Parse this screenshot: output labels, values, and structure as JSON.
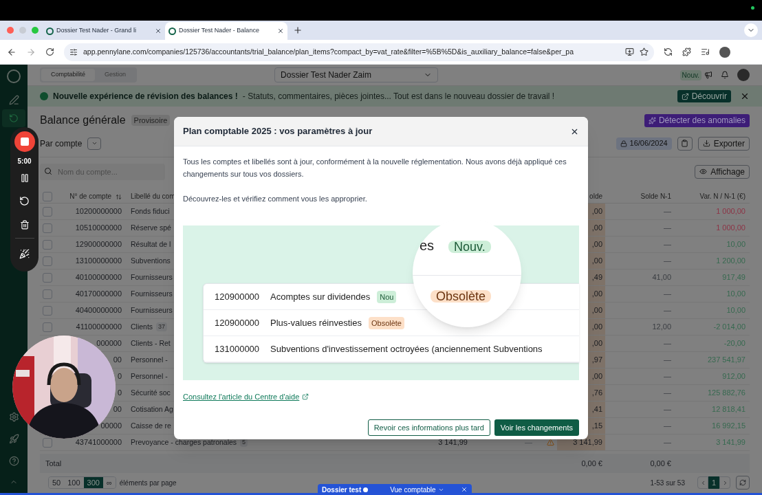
{
  "browser": {
    "tabs": [
      {
        "title": "Dossier Test Nader - Grand li",
        "selected": false
      },
      {
        "title": "Dossier Test Nader - Balance",
        "selected": true
      }
    ],
    "url": "app.pennylane.com/companies/125736/accountants/trial_balance/plan_items?compact_by=vat_rate&filter=%5B%5D&is_auxiliary_balance=false&per_pa"
  },
  "app_header": {
    "segments": [
      {
        "label": "Comptabilité",
        "selected": true
      },
      {
        "label": "Gestion",
        "selected": false
      }
    ],
    "dossier": "Dossier Test Nader Zaim",
    "badge": "Nouv."
  },
  "banner": {
    "title": "Nouvelle expérience de révision des balances !",
    "text": "- Statuts, commentaires, pièces jointes... Tout est dans le nouveau dossier de travail !",
    "button": "Découvrir"
  },
  "page": {
    "title": "Balance générale",
    "status": "Provisoire",
    "anomalies_button": "Détecter des anomalies",
    "group_by": "Par compte",
    "date": "16/06/2024",
    "export_button": "Exporter",
    "search": {
      "placeholder": "Nom du compte..."
    },
    "display_button": "Affichage"
  },
  "table": {
    "select_all": {
      "checked": false
    },
    "columns": [
      "N° de compte",
      "Libellé du com",
      "olde",
      "Solde N-1",
      "Var. N / N-1 (€)"
    ],
    "rows": [
      {
        "checked": false,
        "account": "10200000000",
        "label": "Fonds fiduci",
        "solde": ",00",
        "n1": "—",
        "var": "1 000,00",
        "color": "#8c3345"
      },
      {
        "checked": false,
        "account": "10510000000",
        "label": "Réserve spé",
        "solde": ",00",
        "n1": "—",
        "var": "1 000,00",
        "color": "#8c3345"
      },
      {
        "checked": false,
        "account": "12900000000",
        "label": "Résultat de l",
        "solde": ",00",
        "n1": "—",
        "var": "10,00",
        "color": "#36694f"
      },
      {
        "checked": false,
        "account": "13100000000",
        "label": "Subventions",
        "solde": ",00",
        "n1": "—",
        "var": "1 200,00",
        "color": "#36694f"
      },
      {
        "checked": false,
        "account": "40100000000",
        "label": "Fournisseurs",
        "solde": ",49",
        "n1": "41,00",
        "var": "917,49",
        "color": "#36694f"
      },
      {
        "checked": false,
        "account": "40170000000",
        "label": "Fournisseurs",
        "solde": ",00",
        "n1": "—",
        "var": "10,00",
        "color": "#36694f"
      },
      {
        "checked": false,
        "account": "40400000000",
        "label": "Fournisseurs",
        "solde": ",00",
        "n1": "—",
        "var": "10,00",
        "color": "#36694f"
      },
      {
        "checked": false,
        "account": "41100000000",
        "label": "Clients",
        "count": "37",
        "solde": ",00",
        "n1": "12,00",
        "var": "-2 014,00",
        "color": "#36694f"
      },
      {
        "account": "000000",
        "label": "Clients - Ret",
        "solde": ",00",
        "n1": "—",
        "var": "-20,00",
        "color": "#36694f"
      },
      {
        "account": "00",
        "label": "Personnel -",
        "solde": ",97",
        "n1": "—",
        "var": "237 541,97",
        "color": "#36694f"
      },
      {
        "account": "0",
        "label": "Personnel -",
        "solde": ",00",
        "n1": "—",
        "var": "912,00",
        "color": "#36694f"
      },
      {
        "account": "0",
        "label": "Sécurité soc",
        "solde": ",76",
        "n1": "—",
        "var": "125 882,76",
        "color": "#36694f"
      },
      {
        "account": "00",
        "label": "Cotisation Ag",
        "solde": ",41",
        "n1": "—",
        "var": "12 818,41",
        "color": "#36694f"
      },
      {
        "account": "00000",
        "label": "Caisse de re",
        "solde": ",15",
        "n1": "—",
        "var": "16 992,15",
        "color": "#36694f"
      },
      {
        "checked": false,
        "account": "43741000000",
        "label": "Prevoyance - charges patronales",
        "count": "5",
        "column_4": "3 141,99",
        "column_5": "—",
        "warning": true,
        "solde": "3 141,99",
        "n1": "—",
        "var": "3 141,99",
        "color": "#36694f"
      }
    ],
    "total": {
      "label": "Total",
      "solde": "0,00 €",
      "n1": "0,00 €"
    }
  },
  "pagination": {
    "sizes": [
      {
        "label": "50",
        "selected": false
      },
      {
        "label": "100",
        "selected": false
      },
      {
        "label": "300",
        "selected": true
      },
      {
        "label": "∞",
        "selected": false
      }
    ],
    "per_page_label": "éléments par page",
    "range": "1-53 sur 53",
    "page": "1"
  },
  "recorder": {
    "time": "5:00"
  },
  "context_bar": {
    "dossier": "Dossier test",
    "view": "Vue comptable"
  },
  "modal": {
    "title": "Plan comptable 2025 : vos paramètres à jour",
    "paragraphs": [
      "Tous les comptes et libellés sont à jour, conformément à la nouvelle réglementation. Nous avons déjà appliqué ces changements sur tous vos dossiers.",
      "Découvrez-les et vérifiez comment vous les approprier."
    ],
    "illustration": {
      "rows": [
        {
          "number": "120900000",
          "label": "Acomptes sur dividendes",
          "tag": {
            "text": "Nou",
            "kind": "new"
          }
        },
        {
          "number": "120900000",
          "label": "Plus-values réinvesties",
          "tag": {
            "text": "Obsolète",
            "kind": "obsolete"
          }
        },
        {
          "number": "131000000",
          "label": "Subventions d'investissement octroyées (anciennement Subventions"
        }
      ],
      "zoom": {
        "text": "es",
        "tags": [
          {
            "text": "Nouv.",
            "kind": "new"
          },
          {
            "text": "Obsolète",
            "kind": "obsolete"
          }
        ]
      }
    },
    "link": "Consultez l'article du Centre d'aide",
    "secondary_button": "Revoir ces informations plus tard",
    "primary_button": "Voir les changements"
  }
}
